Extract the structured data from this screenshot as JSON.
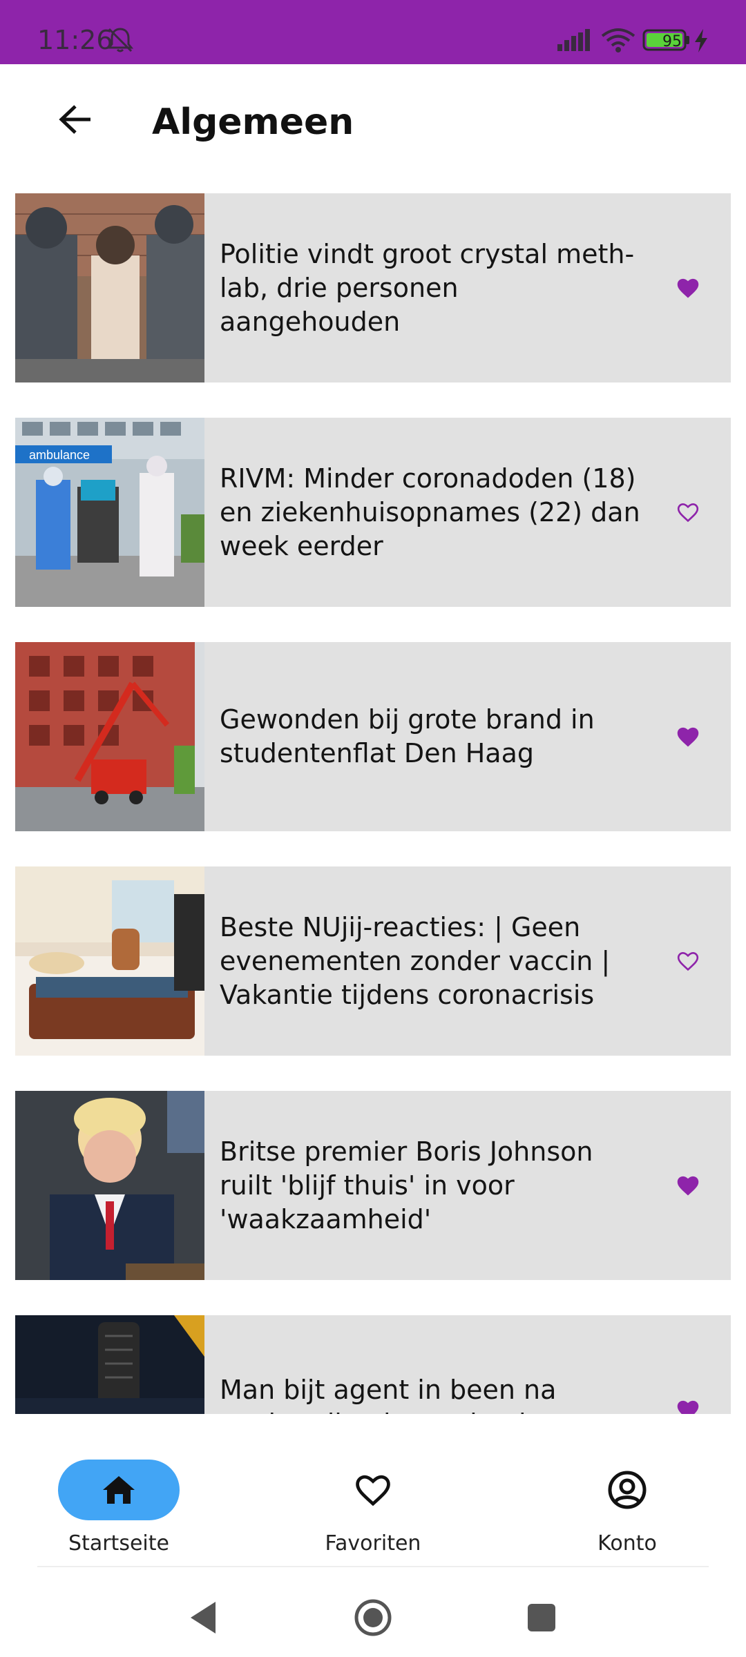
{
  "status_bar": {
    "time": "11:26",
    "battery": "95",
    "icons": [
      "bell-off-icon",
      "signal-icon",
      "wifi-icon",
      "battery-icon",
      "charge-icon"
    ]
  },
  "header": {
    "title": "Algemeen",
    "back_icon": "arrow-left-icon"
  },
  "articles": [
    {
      "title": "Politie vindt groot crystal meth-lab, drie personen aangehouden",
      "favorite": true
    },
    {
      "title": "RIVM: Minder coronadoden (18) en ziekenhuisopnames (22) dan week eerder",
      "favorite": false
    },
    {
      "title": "Gewonden bij grote brand in studentenflat Den Haag",
      "favorite": true
    },
    {
      "title": "Beste NUjij-reacties: | Geen evenementen zonder vaccin | Vakantie tijdens coronacrisis",
      "favorite": false
    },
    {
      "title": "Britse premier Boris Johnson ruilt 'blijf thuis' in voor 'waakzaamheid'",
      "favorite": true
    },
    {
      "title": "Man bijt agent in been na aanhouding in woning in",
      "favorite": true
    }
  ],
  "bottom_nav": {
    "items": [
      {
        "label": "Startseite",
        "icon": "home-icon",
        "active": true
      },
      {
        "label": "Favoriten",
        "icon": "heart-icon",
        "active": false
      },
      {
        "label": "Konto",
        "icon": "account-circle-icon",
        "active": false
      }
    ]
  },
  "colors": {
    "status_bar": "#8e24aa",
    "accent": "#8e24aa",
    "active_nav": "#42a5f5",
    "card_bg": "#e1e1e1"
  }
}
